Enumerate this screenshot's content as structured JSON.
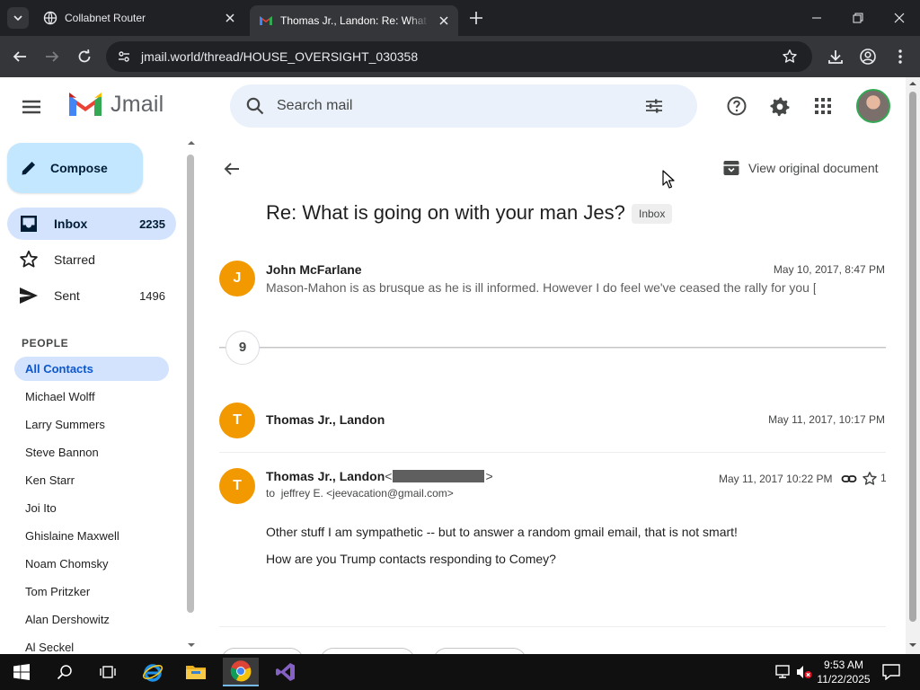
{
  "browser": {
    "tabs": [
      {
        "title": "Collabnet Router",
        "active": false,
        "favicon": "globe-icon"
      },
      {
        "title": "Thomas Jr., Landon: Re: What is going on with your man Jes?",
        "active": true,
        "favicon": "jmail-icon"
      }
    ],
    "url": "jmail.world/thread/HOUSE_OVERSIGHT_030358"
  },
  "app": {
    "name": "Jmail",
    "search_placeholder": "Search mail"
  },
  "sidebar": {
    "compose_label": "Compose",
    "nav": [
      {
        "label": "Inbox",
        "count": "2235",
        "icon": "inbox-icon",
        "active": true
      },
      {
        "label": "Starred",
        "count": "",
        "icon": "star-icon",
        "active": false
      },
      {
        "label": "Sent",
        "count": "1496",
        "icon": "send-icon",
        "active": false
      }
    ],
    "people_heading": "PEOPLE",
    "contacts": [
      "All Contacts",
      "Michael Wolff",
      "Larry Summers",
      "Steve Bannon",
      "Ken Starr",
      "Joi Ito",
      "Ghislaine Maxwell",
      "Noam Chomsky",
      "Tom Pritzker",
      "Alan Dershowitz",
      "Al Seckel"
    ]
  },
  "thread": {
    "view_original_label": "View original document",
    "subject": "Re: What is going on with your man Jes?",
    "label_badge": "Inbox",
    "collapsed_count": "9",
    "messages": [
      {
        "initial": "J",
        "sender": "John McFarlane",
        "date": "May 10, 2017, 8:47 PM",
        "snippet": "Mason-Mahon is as brusque as he is ill informed. However I do feel we've ceased the rally for you ["
      },
      {
        "initial": "T",
        "sender": "Thomas Jr., Landon",
        "date": "May 11, 2017, 10:17 PM"
      },
      {
        "initial": "T",
        "sender": "Thomas Jr., Landon",
        "email_open": "<",
        "email_close": ">",
        "date": "May 11, 2017 10:22 PM",
        "star_count": "1",
        "to_prefix": "to",
        "to": "jeffrey E. <jeevacation@gmail.com>",
        "body": [
          "Other stuff I am sympathetic -- but to answer a random gmail email, that is not smart!",
          "How are you Trump contacts responding to Comey?"
        ]
      }
    ]
  },
  "taskbar": {
    "time": "9:53 AM",
    "date": "11/22/2025"
  },
  "colors": {
    "accent": "#0b57d0",
    "compose_bg": "#c2e7ff",
    "selected_bg": "#d3e3fd",
    "avatar_orange": "#f29900",
    "search_bg": "#eaf1fb"
  }
}
